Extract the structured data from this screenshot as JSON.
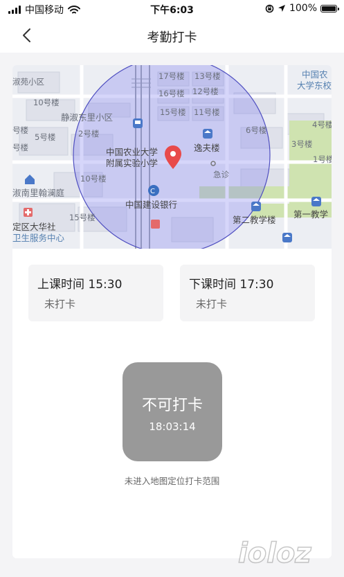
{
  "status_bar": {
    "carrier": "中国移动",
    "time": "下午6:03",
    "battery": "100%"
  },
  "nav": {
    "title": "考勤打卡",
    "back_icon": "chevron-left-icon"
  },
  "map": {
    "labels": {
      "l0": "淑苑小区",
      "l1": "17号楼",
      "l2": "13号楼",
      "l3": "中国农",
      "l4": "大学东校",
      "l5": "10号楼",
      "l6": "16号楼",
      "l7": "12号楼",
      "l8": "静淑东里小区",
      "l9": "15号楼",
      "l10": "11号楼",
      "l11": "号楼",
      "l12": "2号楼",
      "l13": "6号楼",
      "l14": "4号楼",
      "l15": "号楼",
      "l16": "5号楼",
      "l17": "逸夫楼",
      "l18": "3号楼",
      "l19": "中国农业大学",
      "l20": "1号楼",
      "l21": "附属实验小学",
      "l22": "急诊",
      "l23": "10号楼",
      "l24": "淑南里翰澜庭",
      "l25": "中国建设银行",
      "l26": "第二教学楼",
      "l27": "第一教学",
      "l28": "15号楼",
      "l29": "定区大华社",
      "l30": "卫生服务中心"
    },
    "colors": {
      "geofence_fill": "#7f7ff0",
      "geofence_stroke": "#4f4fc0",
      "pin": "#e84a4a",
      "road": "#ffffff",
      "building": "#dfe1ea",
      "green": "#cfe3b0"
    }
  },
  "shifts": {
    "start": {
      "title": "上课时间 15:30",
      "status": "未打卡"
    },
    "end": {
      "title": "下课时间 17:30",
      "status": "未打卡"
    }
  },
  "punch": {
    "label": "不可打卡",
    "time": "18:03:14",
    "hint": "未进入地图定位打卡范围",
    "color": "#999999"
  },
  "watermark": {
    "text": "ioloz"
  }
}
